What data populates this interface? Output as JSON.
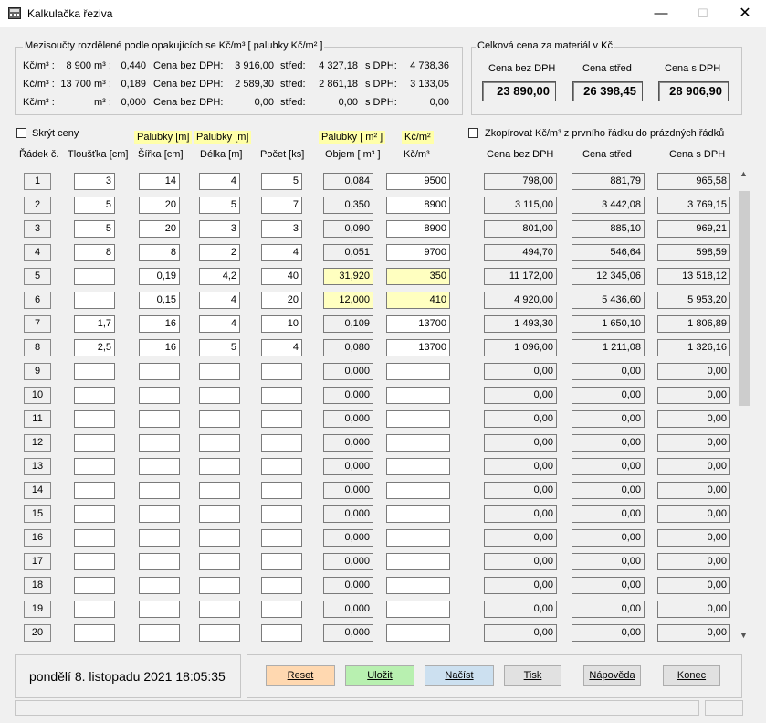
{
  "window": {
    "title": "Kalkulačka řeziva",
    "minimize": "—",
    "maximize": "☐",
    "close": "✕"
  },
  "subtotals": {
    "legend": "Mezisoučty rozdělené podle opakujících se Kč/m³  [ palubky Kč/m² ]",
    "rows": [
      {
        "kc_label": "Kč/m³ :",
        "kc": "8 900",
        "m3_label": "m³ :",
        "m3": "0,440",
        "bez_label": "Cena bez DPH:",
        "bez": "3 916,00",
        "stred_label": "střed:",
        "stred": "4 327,18",
        "s_label": "s DPH:",
        "s": "4 738,36"
      },
      {
        "kc_label": "Kč/m³ :",
        "kc": "13 700",
        "m3_label": "m³ :",
        "m3": "0,189",
        "bez_label": "Cena bez DPH:",
        "bez": "2 589,30",
        "stred_label": "střed:",
        "stred": "2 861,18",
        "s_label": "s DPH:",
        "s": "3 133,05"
      },
      {
        "kc_label": "Kč/m³ :",
        "kc": "",
        "m3_label": "m³ :",
        "m3": "0,000",
        "bez_label": "Cena bez DPH:",
        "bez": "0,00",
        "stred_label": "střed:",
        "stred": "0,00",
        "s_label": "s DPH:",
        "s": "0,00"
      }
    ]
  },
  "totals": {
    "legend": "Celková cena za materiál v Kč",
    "bez_label": "Cena bez DPH",
    "bez": "23 890,00",
    "stred_label": "Cena střed",
    "stred": "26 398,45",
    "s_label": "Cena s DPH",
    "s": "28 906,90"
  },
  "options": {
    "hide_prices": "Skrýt ceny",
    "copy_price": "Zkopírovat Kč/m³ z prvního řádku do prázdných řádků"
  },
  "columns": {
    "palubky_m_1": "Palubky [m]",
    "palubky_m_2": "Palubky [m]",
    "palubky_m2": "Palubky [ m² ]",
    "kc_m2": "Kč/m²",
    "row": "Řádek č.",
    "thickness": "Tloušťka [cm]",
    "width": "Šířka [cm]",
    "length": "Délka [m]",
    "count": "Počet [ks]",
    "volume": "Objem [ m³ ]",
    "price": "Kč/m³",
    "bez": "Cena bez DPH",
    "stred": "Cena střed",
    "s": "Cena s DPH"
  },
  "rows": [
    {
      "n": "1",
      "t": "3",
      "w": "14",
      "l": "4",
      "c": "5",
      "v": "0,084",
      "p": "9500",
      "bez": "798,00",
      "stred": "881,79",
      "s": "965,58",
      "hl": false
    },
    {
      "n": "2",
      "t": "5",
      "w": "20",
      "l": "5",
      "c": "7",
      "v": "0,350",
      "p": "8900",
      "bez": "3 115,00",
      "stred": "3 442,08",
      "s": "3 769,15",
      "hl": false
    },
    {
      "n": "3",
      "t": "5",
      "w": "20",
      "l": "3",
      "c": "3",
      "v": "0,090",
      "p": "8900",
      "bez": "801,00",
      "stred": "885,10",
      "s": "969,21",
      "hl": false
    },
    {
      "n": "4",
      "t": "8",
      "w": "8",
      "l": "2",
      "c": "4",
      "v": "0,051",
      "p": "9700",
      "bez": "494,70",
      "stred": "546,64",
      "s": "598,59",
      "hl": false
    },
    {
      "n": "5",
      "t": "",
      "w": "0,19",
      "l": "4,2",
      "c": "40",
      "v": "31,920",
      "p": "350",
      "bez": "11 172,00",
      "stred": "12 345,06",
      "s": "13 518,12",
      "hl": true
    },
    {
      "n": "6",
      "t": "",
      "w": "0,15",
      "l": "4",
      "c": "20",
      "v": "12,000",
      "p": "410",
      "bez": "4 920,00",
      "stred": "5 436,60",
      "s": "5 953,20",
      "hl": true
    },
    {
      "n": "7",
      "t": "1,7",
      "w": "16",
      "l": "4",
      "c": "10",
      "v": "0,109",
      "p": "13700",
      "bez": "1 493,30",
      "stred": "1 650,10",
      "s": "1 806,89",
      "hl": false
    },
    {
      "n": "8",
      "t": "2,5",
      "w": "16",
      "l": "5",
      "c": "4",
      "v": "0,080",
      "p": "13700",
      "bez": "1 096,00",
      "stred": "1 211,08",
      "s": "1 326,16",
      "hl": false
    },
    {
      "n": "9",
      "t": "",
      "w": "",
      "l": "",
      "c": "",
      "v": "0,000",
      "p": "",
      "bez": "0,00",
      "stred": "0,00",
      "s": "0,00",
      "hl": false
    },
    {
      "n": "10",
      "t": "",
      "w": "",
      "l": "",
      "c": "",
      "v": "0,000",
      "p": "",
      "bez": "0,00",
      "stred": "0,00",
      "s": "0,00",
      "hl": false
    },
    {
      "n": "11",
      "t": "",
      "w": "",
      "l": "",
      "c": "",
      "v": "0,000",
      "p": "",
      "bez": "0,00",
      "stred": "0,00",
      "s": "0,00",
      "hl": false
    },
    {
      "n": "12",
      "t": "",
      "w": "",
      "l": "",
      "c": "",
      "v": "0,000",
      "p": "",
      "bez": "0,00",
      "stred": "0,00",
      "s": "0,00",
      "hl": false
    },
    {
      "n": "13",
      "t": "",
      "w": "",
      "l": "",
      "c": "",
      "v": "0,000",
      "p": "",
      "bez": "0,00",
      "stred": "0,00",
      "s": "0,00",
      "hl": false
    },
    {
      "n": "14",
      "t": "",
      "w": "",
      "l": "",
      "c": "",
      "v": "0,000",
      "p": "",
      "bez": "0,00",
      "stred": "0,00",
      "s": "0,00",
      "hl": false
    },
    {
      "n": "15",
      "t": "",
      "w": "",
      "l": "",
      "c": "",
      "v": "0,000",
      "p": "",
      "bez": "0,00",
      "stred": "0,00",
      "s": "0,00",
      "hl": false
    },
    {
      "n": "16",
      "t": "",
      "w": "",
      "l": "",
      "c": "",
      "v": "0,000",
      "p": "",
      "bez": "0,00",
      "stred": "0,00",
      "s": "0,00",
      "hl": false
    },
    {
      "n": "17",
      "t": "",
      "w": "",
      "l": "",
      "c": "",
      "v": "0,000",
      "p": "",
      "bez": "0,00",
      "stred": "0,00",
      "s": "0,00",
      "hl": false
    },
    {
      "n": "18",
      "t": "",
      "w": "",
      "l": "",
      "c": "",
      "v": "0,000",
      "p": "",
      "bez": "0,00",
      "stred": "0,00",
      "s": "0,00",
      "hl": false
    },
    {
      "n": "19",
      "t": "",
      "w": "",
      "l": "",
      "c": "",
      "v": "0,000",
      "p": "",
      "bez": "0,00",
      "stred": "0,00",
      "s": "0,00",
      "hl": false
    },
    {
      "n": "20",
      "t": "",
      "w": "",
      "l": "",
      "c": "",
      "v": "0,000",
      "p": "",
      "bez": "0,00",
      "stred": "0,00",
      "s": "0,00",
      "hl": false
    }
  ],
  "footer": {
    "datetime": "pondělí 8. listopadu 2021   18:05:35",
    "buttons": [
      {
        "id": "reset",
        "label": "Reset",
        "color": "#ffd8b0"
      },
      {
        "id": "save",
        "label": "Uložit",
        "color": "#b8f0b0"
      },
      {
        "id": "load",
        "label": "Načíst",
        "color": "#cce0f0"
      },
      {
        "id": "print",
        "label": "Tisk",
        "color": "#e1e1e1"
      },
      {
        "id": "help",
        "label": "Nápověda",
        "color": "#e1e1e1"
      },
      {
        "id": "end",
        "label": "Konec",
        "color": "#e1e1e1"
      }
    ]
  },
  "scrollbar": {
    "up_icon": "▲",
    "down_icon": "▼"
  }
}
